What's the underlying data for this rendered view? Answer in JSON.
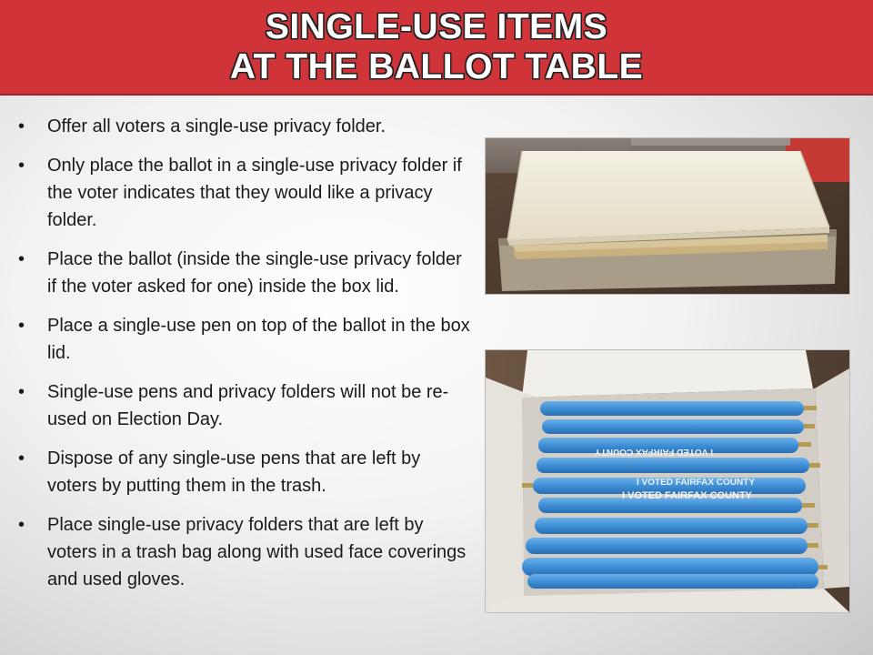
{
  "slide": {
    "title_lines": [
      "SINGLE-USE ITEMS",
      "AT THE BALLOT TABLE"
    ],
    "bullets": [
      "Offer all voters a single-use privacy folder.",
      "Only place the ballot in a single-use privacy folder if the voter indicates that they would like a privacy folder.",
      "Place the ballot (inside the single-use privacy folder if the voter asked for one) inside the box lid.",
      "Place a single-use pen on top of the ballot in the box lid.",
      "Single-use pens and privacy folders will not be re-used on Election Day.",
      "Dispose of any single-use pens that are left by voters by putting them in the trash.",
      "Place single-use privacy folders that are left by voters in a trash bag along with used face coverings and used gloves."
    ],
    "bullet_glyph": "•",
    "pen_imprint_1": "I VOTED FAIRFAX COUNTY",
    "pen_imprint_2": "I VOTED FAIRFAX COUNTY",
    "pen_imprint_3": "I VOTED FAIRFAX COUNTY"
  },
  "colors": {
    "banner": "#d13438",
    "pen_blue": "#3f8fd6",
    "folder_cream": "#efe9d6"
  }
}
